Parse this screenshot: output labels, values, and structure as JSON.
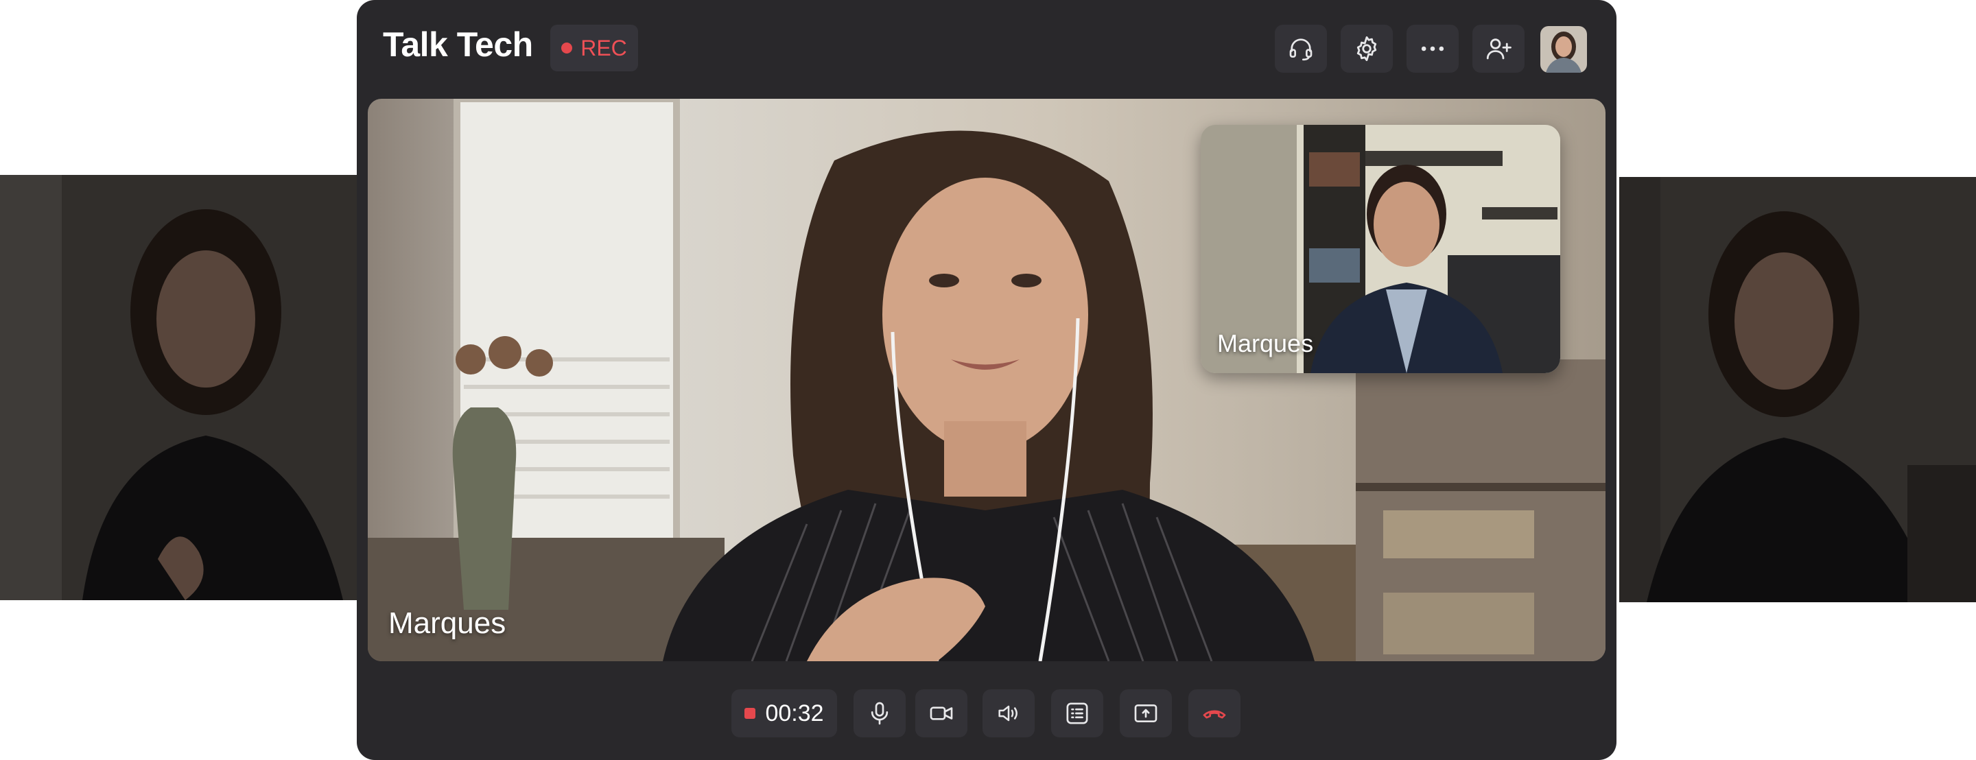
{
  "app": {
    "title": "Talk Tech",
    "rec_label": "REC"
  },
  "header_buttons": [
    {
      "name": "headset-button",
      "icon": "headset-icon"
    },
    {
      "name": "settings-button",
      "icon": "gear-icon"
    },
    {
      "name": "more-button",
      "icon": "more-horizontal-icon"
    },
    {
      "name": "add-participant-button",
      "icon": "user-plus-icon"
    }
  ],
  "main_video": {
    "participant_name": "Marques"
  },
  "pip_video": {
    "participant_name": "Marques"
  },
  "call": {
    "timer": "00:32"
  },
  "controls": [
    {
      "name": "microphone-button",
      "icon": "microphone-icon"
    },
    {
      "name": "camera-button",
      "icon": "video-camera-icon"
    },
    {
      "name": "speaker-button",
      "icon": "speaker-icon"
    },
    {
      "name": "chat-list-button",
      "icon": "list-icon"
    },
    {
      "name": "share-screen-button",
      "icon": "share-screen-icon"
    },
    {
      "name": "end-call-button",
      "icon": "phone-hangup-icon"
    }
  ],
  "colors": {
    "window_bg": "#29282b",
    "button_bg": "#333237",
    "accent_red": "#e5484d"
  }
}
